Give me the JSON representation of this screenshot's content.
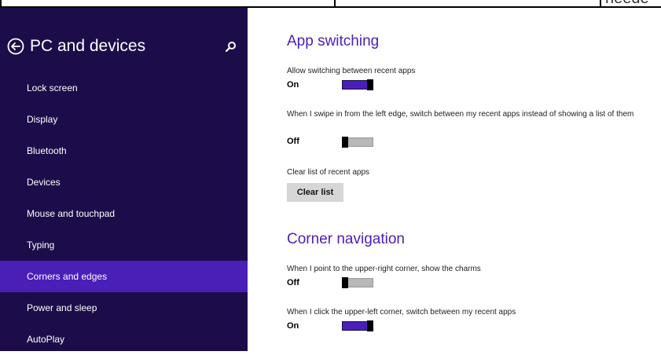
{
  "top_strip": {
    "cropped_text": "neede"
  },
  "sidebar": {
    "title": "PC and devices",
    "back_icon": "back-arrow-circle-icon",
    "search_icon": "search-icon",
    "items": [
      {
        "label": "Lock screen",
        "selected": false
      },
      {
        "label": "Display",
        "selected": false
      },
      {
        "label": "Bluetooth",
        "selected": false
      },
      {
        "label": "Devices",
        "selected": false
      },
      {
        "label": "Mouse and touchpad",
        "selected": false
      },
      {
        "label": "Typing",
        "selected": false
      },
      {
        "label": "Corners and edges",
        "selected": true
      },
      {
        "label": "Power and sleep",
        "selected": false
      },
      {
        "label": "AutoPlay",
        "selected": false
      }
    ]
  },
  "main": {
    "app_switching": {
      "title": "App switching",
      "allow_switching": {
        "label": "Allow switching between recent apps",
        "state": "On"
      },
      "swipe_left": {
        "label": "When I swipe in from the left edge, switch between my recent apps instead of showing a list of them",
        "state": "Off"
      },
      "clear_list": {
        "label": "Clear list of recent apps",
        "button": "Clear list"
      }
    },
    "corner_navigation": {
      "title": "Corner navigation",
      "upper_right": {
        "label": "When I point to the upper-right corner, show the charms",
        "state": "Off"
      },
      "upper_left": {
        "label": "When I click the upper-left corner, switch between my recent apps",
        "state": "On"
      }
    }
  },
  "colors": {
    "sidebar_bg": "#1c0d4a",
    "accent": "#4a1fb8"
  }
}
